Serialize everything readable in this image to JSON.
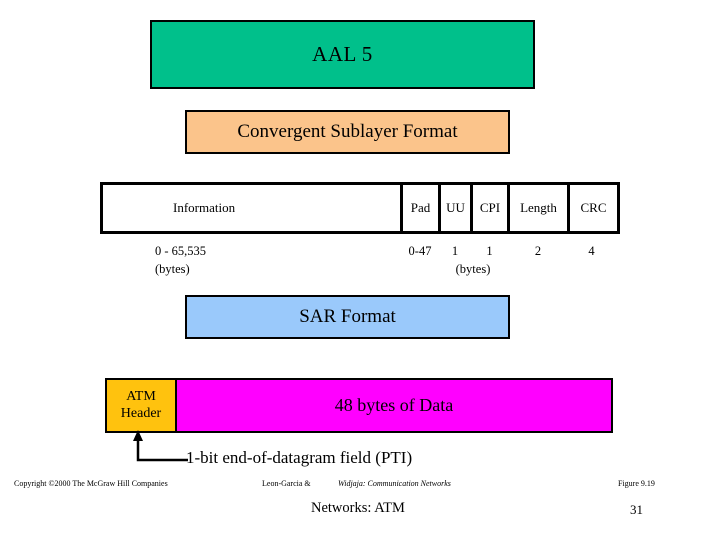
{
  "slide": {
    "title": "AAL 5",
    "colors": {
      "title_banner": "#00C08B",
      "cs_heading": "#FBC48B",
      "sar_heading": "#9AC9FB",
      "atm_header": "#FFC20E",
      "payload": "#FF00FF",
      "outline": "#000000"
    }
  },
  "convergent_sublayer": {
    "heading": "Convergent Sublayer Format",
    "fields": [
      {
        "label": "Information",
        "size": "0 - 65,535"
      },
      {
        "label": "Pad",
        "size": "0-47"
      },
      {
        "label": "UU",
        "size": "1"
      },
      {
        "label": "CPI",
        "size": "1"
      },
      {
        "label": "Length",
        "size": "2"
      },
      {
        "label": "CRC",
        "size": "4"
      }
    ],
    "units_left": "(bytes)",
    "units_right": "(bytes)"
  },
  "sar": {
    "heading": "SAR Format",
    "header_line1": "ATM",
    "header_line2": "Header",
    "payload": "48 bytes of Data",
    "callout": "1-bit end-of-datagram field (PTI)"
  },
  "footer": {
    "copyright": "Copyright ©2000 The McGraw Hill Companies",
    "authors": "Leon-Garcia &",
    "book_title": "Widjaja:  Communication Networks",
    "figure": "Figure 9.19",
    "course": "Networks: ATM",
    "page": "31"
  }
}
